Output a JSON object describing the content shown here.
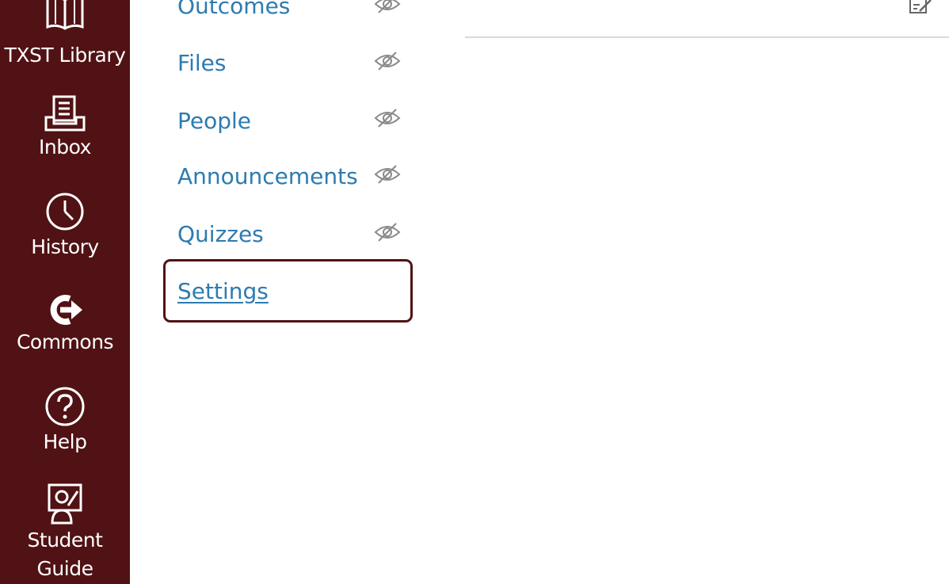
{
  "global_nav": {
    "background": "#501214",
    "items": [
      {
        "label": "TXST Library",
        "icon": "book-icon"
      },
      {
        "label": "Inbox",
        "icon": "inbox-icon"
      },
      {
        "label": "History",
        "icon": "clock-icon"
      },
      {
        "label": "Commons",
        "icon": "commons-icon"
      },
      {
        "label": "Help",
        "icon": "help-icon"
      },
      {
        "label_line1": "Student",
        "label_line2": "Guide",
        "icon": "student-guide-icon"
      }
    ]
  },
  "course_nav": {
    "link_color": "#2d7bb0",
    "items": [
      {
        "label": "Outcomes",
        "hidden": true
      },
      {
        "label": "Files",
        "hidden": true
      },
      {
        "label": "People",
        "hidden": true
      },
      {
        "label": "Announcements",
        "hidden": true
      },
      {
        "label": "Quizzes",
        "hidden": true
      },
      {
        "label": "Settings",
        "hidden": false,
        "focused": true
      }
    ]
  },
  "main": {
    "edit_icon": "edit-icon"
  }
}
